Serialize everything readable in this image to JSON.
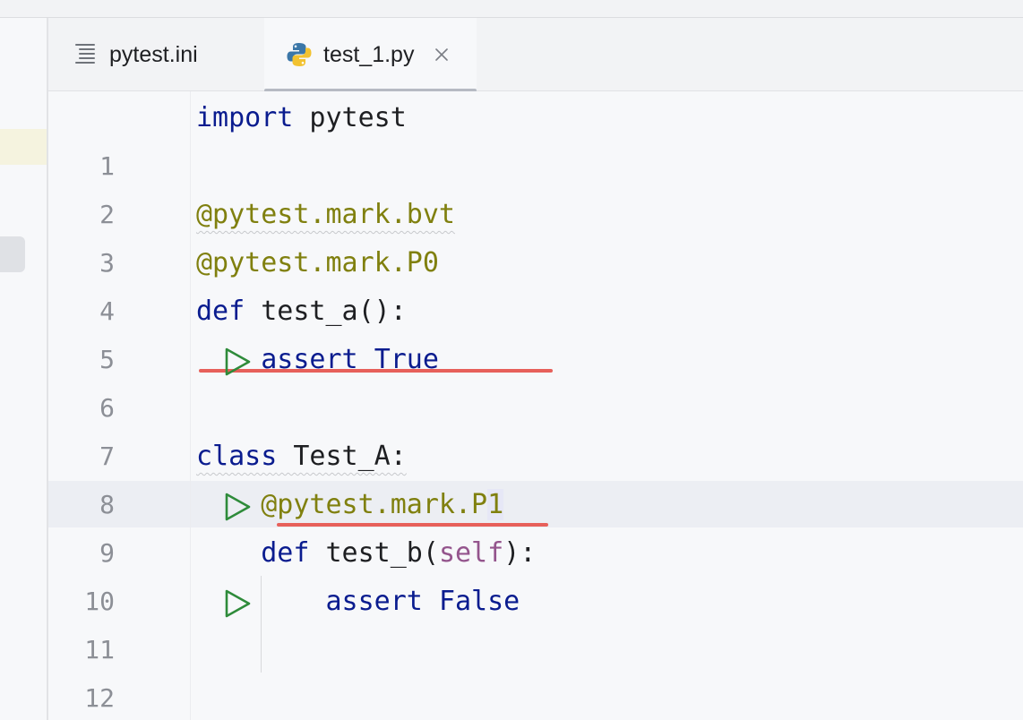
{
  "tabs": [
    {
      "label": "pytest.ini",
      "icon": "text-file-icon"
    },
    {
      "label": "test_1.py",
      "icon": "python-file-icon",
      "active": true
    }
  ],
  "editor": {
    "lines": [
      {
        "n": "1"
      },
      {
        "n": "2"
      },
      {
        "n": "3"
      },
      {
        "n": "4"
      },
      {
        "n": "5"
      },
      {
        "n": "6"
      },
      {
        "n": "7"
      },
      {
        "n": "8"
      },
      {
        "n": "9"
      },
      {
        "n": "10"
      },
      {
        "n": "11"
      },
      {
        "n": "12"
      }
    ],
    "code": {
      "l1_kw": "import",
      "l1_rest": " pytest",
      "l3": "@pytest.mark.bvt",
      "l4": "@pytest.mark.P0",
      "l5_kw": "def",
      "l5_rest": " test_a():",
      "l6_indent": "    ",
      "l6_kw": "assert",
      "l6_sp": " ",
      "l6_val": "True",
      "l8_kw": "class",
      "l8_rest": " Test_A:",
      "l9_indent": "    ",
      "l9_a": "@pytest.mark.P",
      "l9_b": "1",
      "l10_indent": "    ",
      "l10_kw": "def",
      "l10_a": " test_b(",
      "l10_self": "self",
      "l10_b": "):",
      "l11_indent": "        ",
      "l11_kw": "assert",
      "l11_sp": " ",
      "l11_val": "False"
    }
  },
  "colors": {
    "keyword": "#0a1c8f",
    "decorator": "#80800f",
    "self": "#94558d",
    "run_icon": "#2e8b3a",
    "error_underline": "#e7605a"
  }
}
